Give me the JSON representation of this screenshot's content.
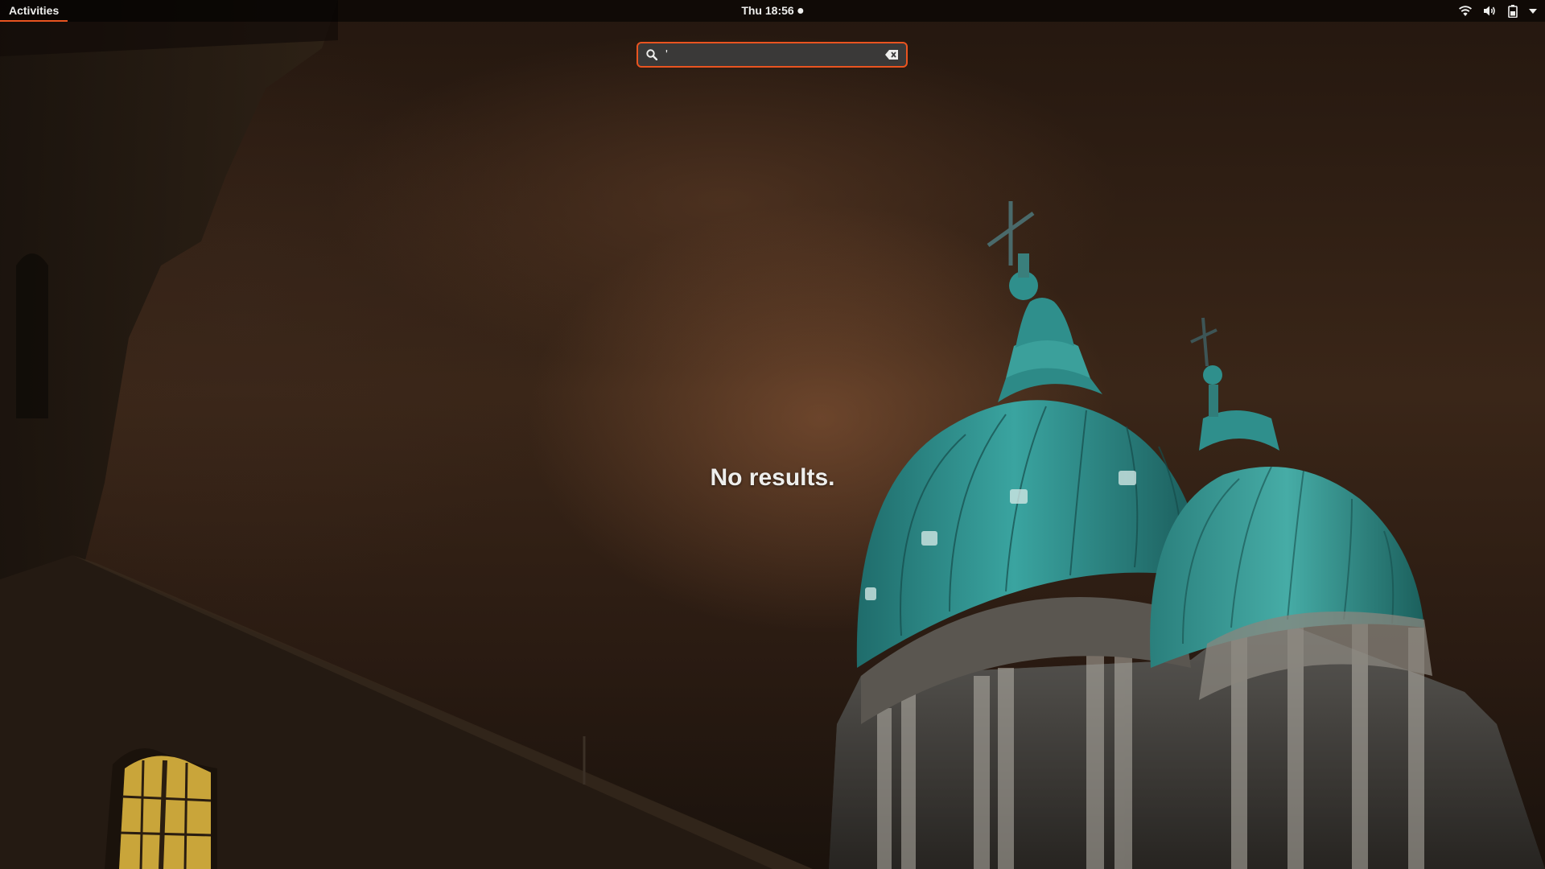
{
  "top_bar": {
    "activities_label": "Activities",
    "clock_label": "Thu 18:56",
    "status_icons": [
      "wifi-icon",
      "volume-icon",
      "battery-icon",
      "system-menu-chevron-icon"
    ]
  },
  "search": {
    "value": "'",
    "search_icon": "search-icon",
    "clear_icon": "clear-text-icon"
  },
  "results": {
    "message": "No results."
  },
  "colors": {
    "accent": "#e95420",
    "panel_text": "#eeeeec",
    "dome_teal": "#2f8f8c"
  }
}
